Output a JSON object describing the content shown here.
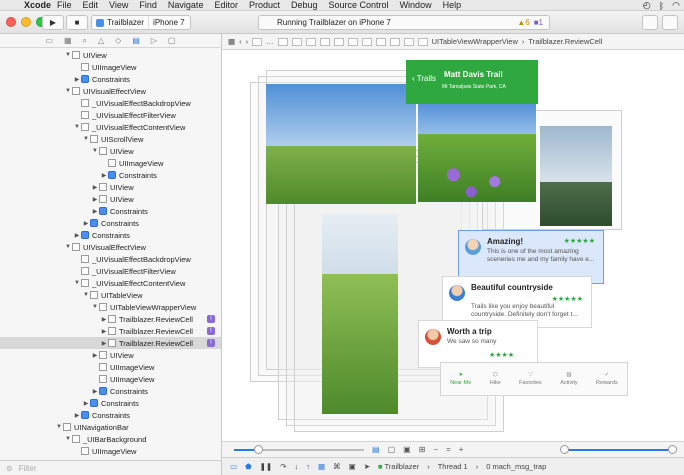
{
  "menubar": {
    "app": "Xcode",
    "items": [
      "File",
      "Edit",
      "View",
      "Find",
      "Navigate",
      "Editor",
      "Product",
      "Debug",
      "Source Control",
      "Window",
      "Help"
    ]
  },
  "toolbar": {
    "scheme_target": "Trailblazer",
    "scheme_device": "iPhone 7",
    "activity_text": "Running Trailblazer on iPhone 7",
    "warning_count": "6",
    "issue_count": "1"
  },
  "navigator": {
    "rows": [
      {
        "label": "UIView",
        "indent": 0,
        "disc": "▼",
        "icon": "view"
      },
      {
        "label": "UIImageView",
        "indent": 1,
        "disc": "",
        "icon": "view"
      },
      {
        "label": "Constraints",
        "indent": 1,
        "disc": "▶",
        "icon": "constraint"
      },
      {
        "label": "UIVisualEffectView",
        "indent": 0,
        "disc": "▼",
        "icon": "view"
      },
      {
        "label": "_UIVisualEffectBackdropView",
        "indent": 1,
        "disc": "",
        "icon": "view"
      },
      {
        "label": "_UIVisualEffectFilterView",
        "indent": 1,
        "disc": "",
        "icon": "view"
      },
      {
        "label": "_UIVisualEffectContentView",
        "indent": 1,
        "disc": "▼",
        "icon": "view"
      },
      {
        "label": "UIScrollView",
        "indent": 2,
        "disc": "▼",
        "icon": "view"
      },
      {
        "label": "UIView",
        "indent": 3,
        "disc": "▼",
        "icon": "view"
      },
      {
        "label": "UIImageView",
        "indent": 4,
        "disc": "",
        "icon": "view"
      },
      {
        "label": "Constraints",
        "indent": 4,
        "disc": "▶",
        "icon": "constraint"
      },
      {
        "label": "UIView",
        "indent": 3,
        "disc": "▶",
        "icon": "view"
      },
      {
        "label": "UIView",
        "indent": 3,
        "disc": "▶",
        "icon": "view"
      },
      {
        "label": "Constraints",
        "indent": 3,
        "disc": "▶",
        "icon": "constraint"
      },
      {
        "label": "Constraints",
        "indent": 2,
        "disc": "▶",
        "icon": "constraint"
      },
      {
        "label": "Constraints",
        "indent": 1,
        "disc": "▶",
        "icon": "constraint"
      },
      {
        "label": "UIVisualEffectView",
        "indent": 0,
        "disc": "▼",
        "icon": "view"
      },
      {
        "label": "_UIVisualEffectBackdropView",
        "indent": 1,
        "disc": "",
        "icon": "view"
      },
      {
        "label": "_UIVisualEffectFilterView",
        "indent": 1,
        "disc": "",
        "icon": "view"
      },
      {
        "label": "_UIVisualEffectContentView",
        "indent": 1,
        "disc": "▼",
        "icon": "view"
      },
      {
        "label": "UITableView",
        "indent": 2,
        "disc": "▼",
        "icon": "view"
      },
      {
        "label": "UITableViewWrapperView",
        "indent": 3,
        "disc": "▼",
        "icon": "view"
      },
      {
        "label": "Trailblazer.ReviewCell",
        "indent": 4,
        "disc": "▶",
        "icon": "view",
        "badge": "!"
      },
      {
        "label": "Trailblazer.ReviewCell",
        "indent": 4,
        "disc": "▶",
        "icon": "view",
        "badge": "!"
      },
      {
        "label": "Trailblazer.ReviewCell",
        "indent": 4,
        "disc": "▶",
        "icon": "view",
        "badge": "!",
        "selected": true
      },
      {
        "label": "UIView",
        "indent": 3,
        "disc": "▶",
        "icon": "view"
      },
      {
        "label": "UIImageView",
        "indent": 3,
        "disc": "",
        "icon": "view"
      },
      {
        "label": "UIImageView",
        "indent": 3,
        "disc": "",
        "icon": "view"
      },
      {
        "label": "Constraints",
        "indent": 3,
        "disc": "▶",
        "icon": "constraint"
      },
      {
        "label": "Constraints",
        "indent": 2,
        "disc": "▶",
        "icon": "constraint"
      },
      {
        "label": "Constraints",
        "indent": 1,
        "disc": "▶",
        "icon": "constraint"
      },
      {
        "label": "UINavigationBar",
        "indent": -1,
        "disc": "▼",
        "icon": "view"
      },
      {
        "label": "_UIBarBackground",
        "indent": 0,
        "disc": "▼",
        "icon": "view"
      },
      {
        "label": "UIImageView",
        "indent": 1,
        "disc": "",
        "icon": "view"
      }
    ],
    "filter_placeholder": "Filter"
  },
  "jumpbar": {
    "crumbs": [
      "UITableViewWrapperView",
      "Trailblazer.ReviewCell"
    ]
  },
  "canvas": {
    "nav_back": "Trails",
    "nav_title": "Matt Davis Trail",
    "nav_subtitle": "Mt Tamalpais State Park, CA",
    "reviews": [
      {
        "title": "Amazing!",
        "text": "This is one of the most amazing sceneries me and my family have e..."
      },
      {
        "title": "Beautiful countryside",
        "text": "Trails like you enjoy beautiful countryside. Definitely don't forget t..."
      },
      {
        "title": "Worth a trip",
        "text": "We saw so many"
      }
    ],
    "tabs": [
      "Near Me",
      "Hike",
      "Favorites",
      "Activity",
      "Rewards"
    ]
  },
  "debugbar": {
    "app": "Trailblazer",
    "thread": "Thread 1",
    "frame": "0 mach_msg_trap"
  },
  "colors": {
    "accent": "#2a7ae2",
    "trail_green": "#2fa83f",
    "constraint_badge": "#8a6ad8"
  }
}
